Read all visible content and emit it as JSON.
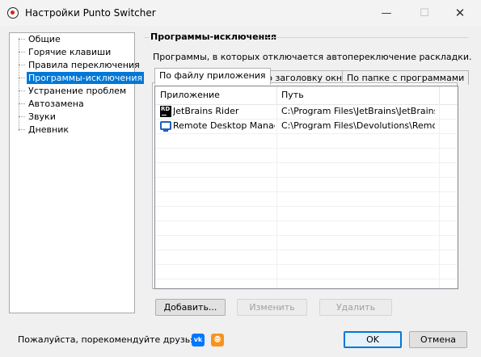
{
  "window": {
    "title": "Настройки Punto Switcher",
    "minimize_glyph": "—",
    "maximize_glyph": "☐",
    "close_glyph": "✕",
    "app_icon": "punto-switcher-icon"
  },
  "sidebar": {
    "items": [
      {
        "label": "Общие",
        "selected": false
      },
      {
        "label": "Горячие клавиши",
        "selected": false
      },
      {
        "label": "Правила переключения",
        "selected": false
      },
      {
        "label": "Программы-исключения",
        "selected": true
      },
      {
        "label": "Устранение проблем",
        "selected": false
      },
      {
        "label": "Автозамена",
        "selected": false
      },
      {
        "label": "Звуки",
        "selected": false
      },
      {
        "label": "Дневник",
        "selected": false
      }
    ]
  },
  "main": {
    "group_title": "Программы-исключения",
    "description": "Программы, в которых отключается автопереключение раскладки.",
    "tabs": [
      {
        "label": "По файлу приложения",
        "active": true
      },
      {
        "label": "По заголовку окна",
        "active": false
      },
      {
        "label": "По папке с программами",
        "active": false
      }
    ],
    "list": {
      "columns": [
        "Приложение",
        "Путь"
      ],
      "rows": [
        {
          "app": "JetBrains Rider",
          "path": "C:\\Program Files\\JetBrains\\JetBrains...",
          "icon": "jetbrains-rider-icon"
        },
        {
          "app": "Remote Desktop Manager",
          "path": "C:\\Program Files\\Devolutions\\Remot...",
          "icon": "remote-desktop-manager-icon"
        }
      ]
    },
    "buttons": {
      "add": "Добавить...",
      "edit": "Изменить",
      "delete": "Удалить"
    }
  },
  "footer": {
    "recommend_text": "Пожалуйста, порекомендуйте друзьям:",
    "vk_label": "vk",
    "ok_label": "ok",
    "ok_button": "OK",
    "cancel_button": "Отмена"
  },
  "colors": {
    "selection": "#0078d7",
    "vk": "#0077ff",
    "odnoklassniki": "#f7931e"
  }
}
